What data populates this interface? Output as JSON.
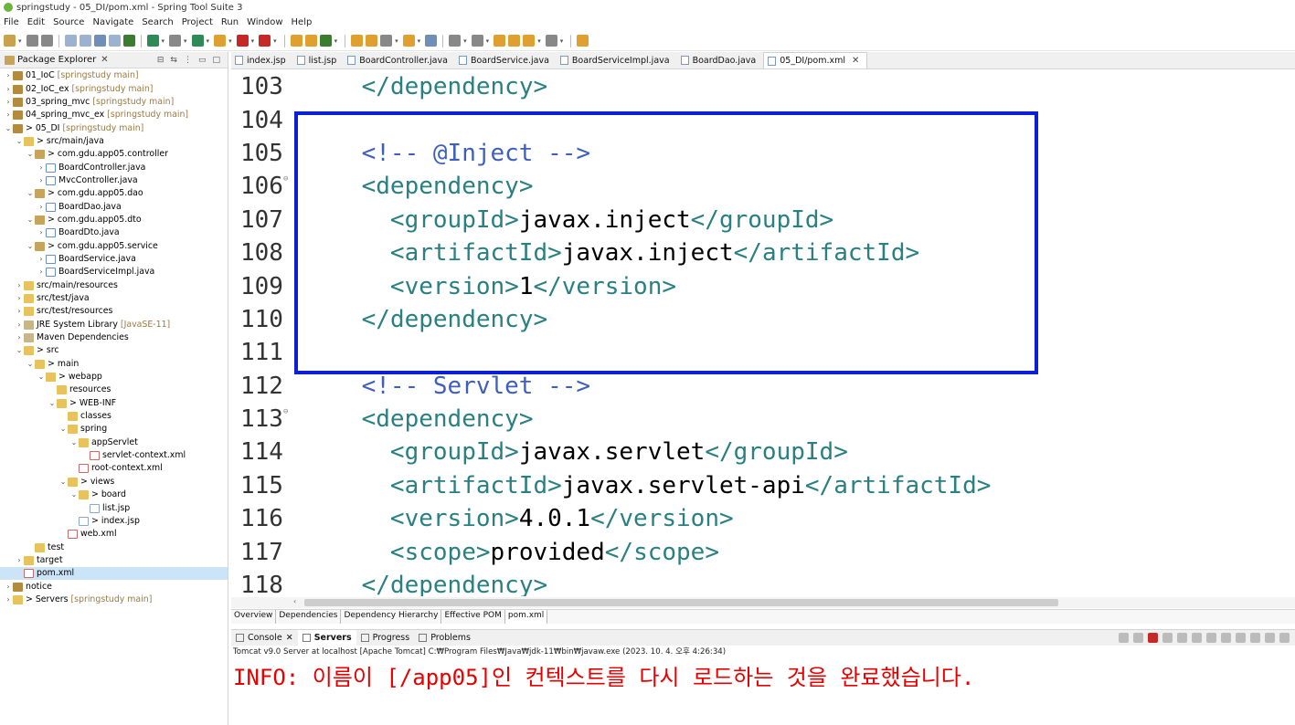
{
  "window": {
    "title": "springstudy - 05_DI/pom.xml - Spring Tool Suite 3"
  },
  "menu": [
    "File",
    "Edit",
    "Source",
    "Navigate",
    "Search",
    "Project",
    "Run",
    "Window",
    "Help"
  ],
  "package_explorer": {
    "title": "Package Explorer",
    "tree": [
      {
        "level": 0,
        "arrow": ">",
        "icon": "proj",
        "label": "01_IoC",
        "extra": "[springstudy main]"
      },
      {
        "level": 0,
        "arrow": ">",
        "icon": "proj",
        "label": "02_IoC_ex",
        "extra": "[springstudy main]"
      },
      {
        "level": 0,
        "arrow": ">",
        "icon": "proj",
        "label": "03_spring_mvc",
        "extra": "[springstudy main]"
      },
      {
        "level": 0,
        "arrow": ">",
        "icon": "proj",
        "label": "04_spring_mvc_ex",
        "extra": "[springstudy main]"
      },
      {
        "level": 0,
        "arrow": "v",
        "icon": "proj",
        "label": "> 05_DI",
        "extra": "[springstudy main]"
      },
      {
        "level": 1,
        "arrow": "v",
        "icon": "folder",
        "label": "> src/main/java",
        "extra": ""
      },
      {
        "level": 2,
        "arrow": "v",
        "icon": "pkg",
        "label": "> com.gdu.app05.controller",
        "extra": ""
      },
      {
        "level": 3,
        "arrow": ">",
        "icon": "java",
        "label": "BoardController.java",
        "extra": ""
      },
      {
        "level": 3,
        "arrow": ">",
        "icon": "java",
        "label": "MvcController.java",
        "extra": ""
      },
      {
        "level": 2,
        "arrow": "v",
        "icon": "pkg",
        "label": "> com.gdu.app05.dao",
        "extra": ""
      },
      {
        "level": 3,
        "arrow": ">",
        "icon": "java",
        "label": "BoardDao.java",
        "extra": ""
      },
      {
        "level": 2,
        "arrow": "v",
        "icon": "pkg",
        "label": "> com.gdu.app05.dto",
        "extra": ""
      },
      {
        "level": 3,
        "arrow": ">",
        "icon": "java",
        "label": "BoardDto.java",
        "extra": ""
      },
      {
        "level": 2,
        "arrow": "v",
        "icon": "pkg",
        "label": "> com.gdu.app05.service",
        "extra": ""
      },
      {
        "level": 3,
        "arrow": ">",
        "icon": "java",
        "label": "BoardService.java",
        "extra": ""
      },
      {
        "level": 3,
        "arrow": ">",
        "icon": "java",
        "label": "BoardServiceImpl.java",
        "extra": ""
      },
      {
        "level": 1,
        "arrow": ">",
        "icon": "folder",
        "label": "src/main/resources",
        "extra": ""
      },
      {
        "level": 1,
        "arrow": ">",
        "icon": "folder",
        "label": "src/test/java",
        "extra": ""
      },
      {
        "level": 1,
        "arrow": ">",
        "icon": "folder",
        "label": "src/test/resources",
        "extra": ""
      },
      {
        "level": 1,
        "arrow": ">",
        "icon": "lib",
        "label": "JRE System Library",
        "extra": "[JavaSE-11]"
      },
      {
        "level": 1,
        "arrow": ">",
        "icon": "lib",
        "label": "Maven Dependencies",
        "extra": ""
      },
      {
        "level": 1,
        "arrow": "v",
        "icon": "folder",
        "label": "> src",
        "extra": ""
      },
      {
        "level": 2,
        "arrow": "v",
        "icon": "folder",
        "label": "> main",
        "extra": ""
      },
      {
        "level": 3,
        "arrow": "v",
        "icon": "folder",
        "label": "> webapp",
        "extra": ""
      },
      {
        "level": 4,
        "arrow": "",
        "icon": "folder",
        "label": "resources",
        "extra": ""
      },
      {
        "level": 4,
        "arrow": "v",
        "icon": "folder",
        "label": "> WEB-INF",
        "extra": ""
      },
      {
        "level": 5,
        "arrow": "",
        "icon": "folder",
        "label": "classes",
        "extra": ""
      },
      {
        "level": 5,
        "arrow": "v",
        "icon": "folder",
        "label": "spring",
        "extra": ""
      },
      {
        "level": 6,
        "arrow": "v",
        "icon": "folder",
        "label": "appServlet",
        "extra": ""
      },
      {
        "level": 7,
        "arrow": "",
        "icon": "xml",
        "label": "servlet-context.xml",
        "extra": ""
      },
      {
        "level": 6,
        "arrow": "",
        "icon": "xml",
        "label": "root-context.xml",
        "extra": ""
      },
      {
        "level": 5,
        "arrow": "v",
        "icon": "folder",
        "label": "> views",
        "extra": ""
      },
      {
        "level": 6,
        "arrow": "v",
        "icon": "folder",
        "label": "> board",
        "extra": ""
      },
      {
        "level": 7,
        "arrow": "",
        "icon": "jsp",
        "label": "list.jsp",
        "extra": ""
      },
      {
        "level": 6,
        "arrow": "",
        "icon": "jsp",
        "label": "> index.jsp",
        "extra": ""
      },
      {
        "level": 5,
        "arrow": "",
        "icon": "xml",
        "label": "web.xml",
        "extra": ""
      },
      {
        "level": 2,
        "arrow": "",
        "icon": "folder",
        "label": "test",
        "extra": ""
      },
      {
        "level": 1,
        "arrow": ">",
        "icon": "folder",
        "label": "target",
        "extra": ""
      },
      {
        "level": 1,
        "arrow": "",
        "icon": "xml",
        "label": "pom.xml",
        "extra": "",
        "selected": true
      },
      {
        "level": 0,
        "arrow": ">",
        "icon": "proj",
        "label": "notice",
        "extra": ""
      },
      {
        "level": 0,
        "arrow": ">",
        "icon": "folder",
        "label": "> Servers",
        "extra": "[springstudy main]"
      }
    ]
  },
  "editor_tabs": [
    {
      "label": "index.jsp"
    },
    {
      "label": "list.jsp"
    },
    {
      "label": "BoardController.java"
    },
    {
      "label": "BoardService.java"
    },
    {
      "label": "BoardServiceImpl.java"
    },
    {
      "label": "BoardDao.java"
    },
    {
      "label": "05_DI/pom.xml",
      "active": true
    }
  ],
  "code_lines": [
    {
      "n": "103",
      "indent": "    ",
      "parts": [
        [
          "br",
          "</"
        ],
        [
          "tag",
          "dependency"
        ],
        [
          "br",
          ">"
        ]
      ]
    },
    {
      "n": "104",
      "indent": "",
      "parts": []
    },
    {
      "n": "105",
      "indent": "    ",
      "parts": [
        [
          "cm",
          "<!-- @Inject -->"
        ]
      ]
    },
    {
      "n": "106",
      "fold": true,
      "indent": "    ",
      "parts": [
        [
          "br",
          "<"
        ],
        [
          "tag",
          "dependency"
        ],
        [
          "br",
          ">"
        ]
      ]
    },
    {
      "n": "107",
      "indent": "      ",
      "parts": [
        [
          "br",
          "<"
        ],
        [
          "tag",
          "groupId"
        ],
        [
          "br",
          ">"
        ],
        [
          "tx",
          "javax.inject"
        ],
        [
          "br",
          "</"
        ],
        [
          "tag",
          "groupId"
        ],
        [
          "br",
          ">"
        ]
      ]
    },
    {
      "n": "108",
      "indent": "      ",
      "parts": [
        [
          "br",
          "<"
        ],
        [
          "tag",
          "artifactId"
        ],
        [
          "br",
          ">"
        ],
        [
          "tx",
          "javax.inject"
        ],
        [
          "br",
          "</"
        ],
        [
          "tag",
          "artifactId"
        ],
        [
          "br",
          ">"
        ]
      ]
    },
    {
      "n": "109",
      "indent": "      ",
      "parts": [
        [
          "br",
          "<"
        ],
        [
          "tag",
          "version"
        ],
        [
          "br",
          ">"
        ],
        [
          "tx",
          "1"
        ],
        [
          "br",
          "</"
        ],
        [
          "tag",
          "version"
        ],
        [
          "br",
          ">"
        ]
      ]
    },
    {
      "n": "110",
      "indent": "    ",
      "parts": [
        [
          "br",
          "</"
        ],
        [
          "tag",
          "dependency"
        ],
        [
          "br",
          ">"
        ]
      ]
    },
    {
      "n": "111",
      "indent": "",
      "parts": []
    },
    {
      "n": "112",
      "indent": "    ",
      "parts": [
        [
          "cm",
          "<!-- Servlet -->"
        ]
      ]
    },
    {
      "n": "113",
      "fold": true,
      "indent": "    ",
      "parts": [
        [
          "br",
          "<"
        ],
        [
          "tag",
          "dependency"
        ],
        [
          "br",
          ">"
        ]
      ]
    },
    {
      "n": "114",
      "indent": "      ",
      "parts": [
        [
          "br",
          "<"
        ],
        [
          "tag",
          "groupId"
        ],
        [
          "br",
          ">"
        ],
        [
          "tx",
          "javax.servlet"
        ],
        [
          "br",
          "</"
        ],
        [
          "tag",
          "groupId"
        ],
        [
          "br",
          ">"
        ]
      ]
    },
    {
      "n": "115",
      "indent": "      ",
      "parts": [
        [
          "br",
          "<"
        ],
        [
          "tag",
          "artifactId"
        ],
        [
          "br",
          ">"
        ],
        [
          "tx",
          "javax.servlet-api"
        ],
        [
          "br",
          "</"
        ],
        [
          "tag",
          "artifactId"
        ],
        [
          "br",
          ">"
        ]
      ]
    },
    {
      "n": "116",
      "indent": "      ",
      "parts": [
        [
          "br",
          "<"
        ],
        [
          "tag",
          "version"
        ],
        [
          "br",
          ">"
        ],
        [
          "tx",
          "4.0.1"
        ],
        [
          "br",
          "</"
        ],
        [
          "tag",
          "version"
        ],
        [
          "br",
          ">"
        ]
      ]
    },
    {
      "n": "117",
      "indent": "      ",
      "parts": [
        [
          "br",
          "<"
        ],
        [
          "tag",
          "scope"
        ],
        [
          "br",
          ">"
        ],
        [
          "tx",
          "provided"
        ],
        [
          "br",
          "</"
        ],
        [
          "tag",
          "scope"
        ],
        [
          "br",
          ">"
        ]
      ]
    },
    {
      "n": "118",
      "indent": "    ",
      "parts": [
        [
          "br",
          "</"
        ],
        [
          "tag",
          "dependency"
        ],
        [
          "br",
          ">"
        ]
      ]
    }
  ],
  "pom_tabs": [
    "Overview",
    "Dependencies",
    "Dependency Hierarchy",
    "Effective POM",
    "pom.xml"
  ],
  "console": {
    "tabs": [
      {
        "label": "Console"
      },
      {
        "label": "Servers",
        "active": true
      },
      {
        "label": "Progress"
      },
      {
        "label": "Problems"
      }
    ],
    "header": "Tomcat v9.0 Server at localhost [Apache Tomcat] C:₩Program Files₩Java₩jdk-11₩bin₩javaw.exe  (2023. 10. 4. 오후 4:26:34)",
    "output": "INFO: 이름이 [/app05]인 컨텍스트를 다시 로드하는 것을 완료했습니다."
  },
  "colors": {
    "highlight_box": "#0a1fd6",
    "tag": "#2a8080",
    "comment": "#3f5fbf",
    "console_error": "#e60000"
  }
}
